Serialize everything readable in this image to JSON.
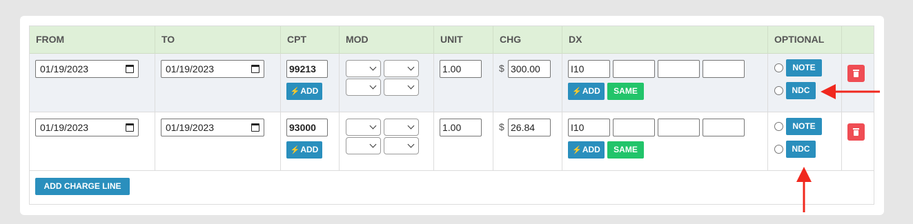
{
  "headers": [
    "FROM",
    "TO",
    "CPT",
    "MOD",
    "UNIT",
    "CHG",
    "DX",
    "OPTIONAL",
    ""
  ],
  "rows": [
    {
      "from": "01/19/2023",
      "to": "01/19/2023",
      "cpt": "99213",
      "add_label": "ADD",
      "unit": "1.00",
      "currency": "$",
      "charge": "300.00",
      "dx": [
        "I10",
        "",
        "",
        ""
      ],
      "dx_add_label": "ADD",
      "same_label": "SAME",
      "note_label": "NOTE",
      "ndc_label": "NDC"
    },
    {
      "from": "01/19/2023",
      "to": "01/19/2023",
      "cpt": "93000",
      "add_label": "ADD",
      "unit": "1.00",
      "currency": "$",
      "charge": "26.84",
      "dx": [
        "I10",
        "",
        "",
        ""
      ],
      "dx_add_label": "ADD",
      "same_label": "SAME",
      "note_label": "NOTE",
      "ndc_label": "NDC"
    }
  ],
  "footer": {
    "add_charge_line_label": "ADD CHARGE LINE"
  },
  "colors": {
    "header_bg": "#dff0d8",
    "primary_button": "#2a8fbd",
    "success_button": "#22c46a",
    "danger_button": "#ef4d54",
    "annotation_arrow": "#f0281e"
  },
  "icons": [
    "calendar-icon",
    "chevron-down-icon",
    "lightning-icon",
    "trash-icon",
    "arrow-icon"
  ]
}
